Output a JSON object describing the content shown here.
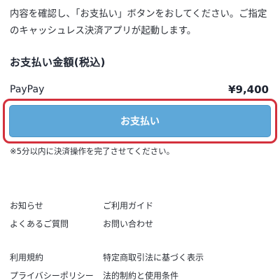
{
  "intro": {
    "line1": "内容を確認し、「お支払い」ボタンをおしてください。ご指定",
    "line2": "のキャッシュレス決済アプリが起動します。"
  },
  "payment": {
    "section_title": "お支払い金額(税込)",
    "method": "PayPay",
    "amount": "¥9,400",
    "button_label": "お支払い",
    "notice": "※5分以内に決済操作を完了させてください。"
  },
  "footer": {
    "rows": [
      [
        "お知らせ",
        "ご利用ガイド"
      ],
      [
        "よくあるご質問",
        "お問い合わせ"
      ],
      [
        "利用規約",
        "特定商取引法に基づく表示"
      ],
      [
        "プライバシーポリシー",
        "法的制約と使用条件"
      ]
    ]
  },
  "colors": {
    "button": "#5ea8d9",
    "highlight_border": "#d3303c"
  }
}
